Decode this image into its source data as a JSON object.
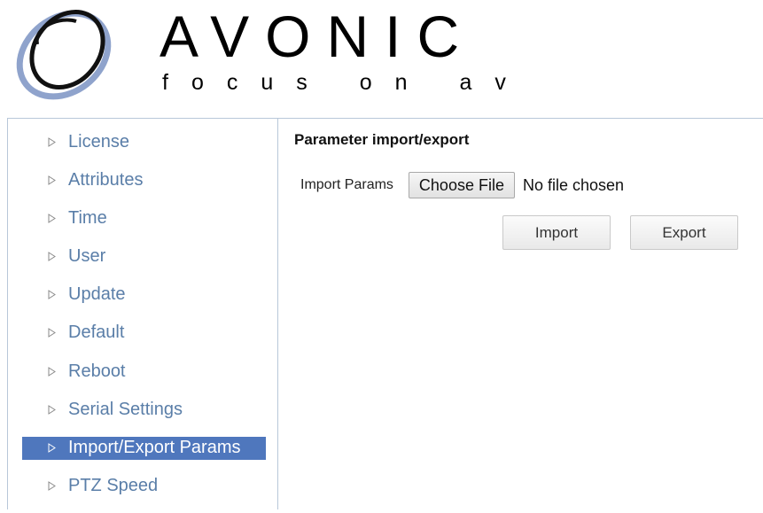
{
  "brand": {
    "name": "AVONIC",
    "tagline": "focus on av"
  },
  "sidebar": {
    "items": [
      {
        "label": "License",
        "active": false
      },
      {
        "label": "Attributes",
        "active": false
      },
      {
        "label": "Time",
        "active": false
      },
      {
        "label": "User",
        "active": false
      },
      {
        "label": "Update",
        "active": false
      },
      {
        "label": "Default",
        "active": false
      },
      {
        "label": "Reboot",
        "active": false
      },
      {
        "label": "Serial Settings",
        "active": false
      },
      {
        "label": "Import/Export Params",
        "active": true
      },
      {
        "label": "PTZ Speed",
        "active": false
      }
    ]
  },
  "main": {
    "title": "Parameter import/export",
    "import_label": "Import Params",
    "choose_file_label": "Choose File",
    "file_status": "No file chosen",
    "import_button": "Import",
    "export_button": "Export"
  },
  "colors": {
    "link": "#5a7ea8",
    "active_bg": "#4f77bd",
    "border": "#b8c7d9",
    "logo_blue": "#8fa3cc"
  }
}
